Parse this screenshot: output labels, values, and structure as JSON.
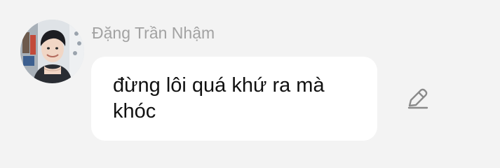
{
  "message": {
    "sender_name": "Đặng Trần Nhậm",
    "text": "đừng lôi quá khứ ra mà khóc",
    "avatar_icon": "user-avatar-photo",
    "edit_icon": "pencil-icon"
  },
  "colors": {
    "background": "#f3f3f3",
    "bubble": "#ffffff",
    "sender_name": "#a2a2a2",
    "text": "#111111",
    "icon": "#8a8a8a"
  }
}
